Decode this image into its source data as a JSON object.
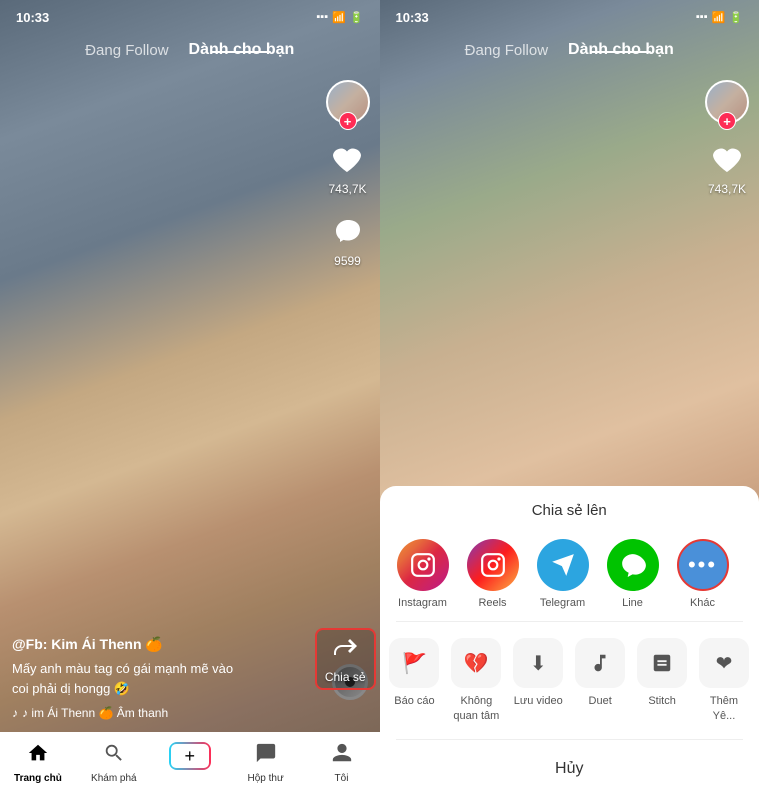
{
  "panels": {
    "left": {
      "time": "10:33",
      "nav_follow": "Đang Follow",
      "nav_for_you": "Dành cho bạn",
      "likes": "743,7K",
      "comments": "9599",
      "share_label": "Chia sẻ",
      "user_handle": "@Fb: Kim Ái Thenn 🍊",
      "video_desc": "Mấy anh màu tag có gái mạnh mẽ vào\ncoi phải dị hongg 🤣",
      "music_label": "♪ im Ái Thenn 🍊 Âm thanh",
      "bottom_nav": {
        "home": "Trang chủ",
        "explore": "Khám phá",
        "inbox": "Hộp thư",
        "profile": "Tôi"
      }
    },
    "right": {
      "time": "10:33",
      "nav_follow": "Đang Follow",
      "nav_for_you": "Dành cho bạn",
      "likes": "743,7K",
      "share_sheet": {
        "title": "Chia sẻ lên",
        "items": [
          {
            "label": "Instagram",
            "type": "instagram"
          },
          {
            "label": "Reels",
            "type": "reels"
          },
          {
            "label": "Telegram",
            "type": "telegram"
          },
          {
            "label": "Line",
            "type": "line"
          },
          {
            "label": "Khác",
            "type": "more"
          }
        ],
        "actions": [
          {
            "label": "Báo cáo",
            "icon": "🚩"
          },
          {
            "label": "Không\nquan tâm",
            "icon": "💔"
          },
          {
            "label": "Lưu video",
            "icon": "⬇"
          },
          {
            "label": "Duet",
            "icon": "🎭"
          },
          {
            "label": "Stitch",
            "icon": "✂"
          },
          {
            "label": "Thêm\nYê...",
            "icon": "❤"
          }
        ],
        "cancel": "Hủy"
      }
    }
  }
}
